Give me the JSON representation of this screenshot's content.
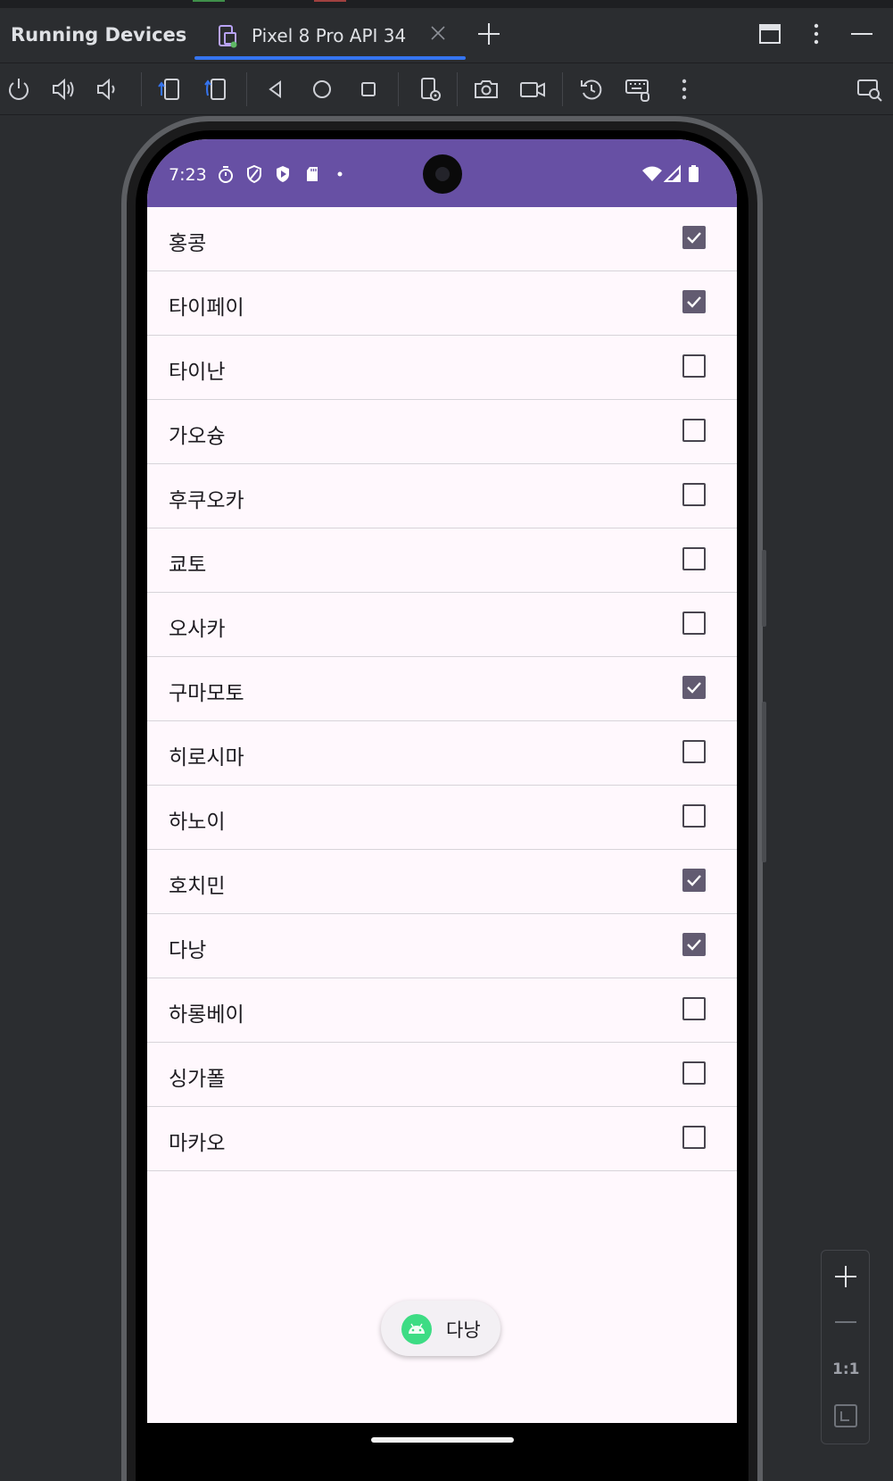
{
  "tool_window": {
    "title": "Running Devices",
    "tab_label": "Pixel 8 Pro API 34"
  },
  "colors": {
    "accent": "#3574f0",
    "status_bar": "#6750a4",
    "checkbox_checked": "#625b71",
    "screen_bg": "#fff8fd",
    "android_green": "#3ddc84"
  },
  "toolbar": {
    "icons": [
      "power-icon",
      "volume-up-icon",
      "volume-down-icon",
      "rotate-left-icon",
      "rotate-right-icon",
      "back-icon",
      "home-icon",
      "overview-icon",
      "device-settings-icon",
      "screenshot-icon",
      "screen-record-icon",
      "reset-icon",
      "keyboard-icon",
      "more-icon",
      "device-mirror-icon"
    ]
  },
  "device": {
    "status_time": "7:23",
    "items": [
      {
        "label": "홍콩",
        "checked": true
      },
      {
        "label": "타이페이",
        "checked": true
      },
      {
        "label": "타이난",
        "checked": false
      },
      {
        "label": "가오슝",
        "checked": false
      },
      {
        "label": "후쿠오카",
        "checked": false
      },
      {
        "label": "쿄토",
        "checked": false
      },
      {
        "label": "오사카",
        "checked": false
      },
      {
        "label": "구마모토",
        "checked": true
      },
      {
        "label": "히로시마",
        "checked": false
      },
      {
        "label": "하노이",
        "checked": false
      },
      {
        "label": "호치민",
        "checked": true
      },
      {
        "label": "다낭",
        "checked": true
      },
      {
        "label": "하롱베이",
        "checked": false
      },
      {
        "label": "싱가폴",
        "checked": false
      },
      {
        "label": "마카오",
        "checked": false
      }
    ],
    "toast_text": "다낭"
  },
  "zoom": {
    "ratio_label": "1:1"
  }
}
